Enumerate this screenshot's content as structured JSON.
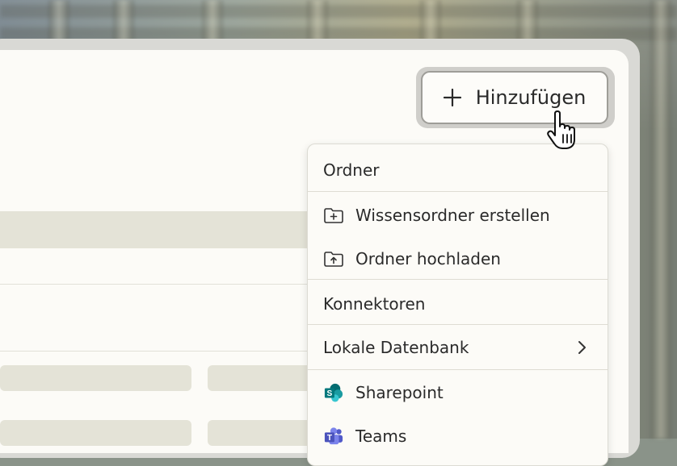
{
  "header": {
    "add_button_label": "Hinzufügen",
    "add_button_icon": "plus-icon"
  },
  "dropdown": {
    "sections": [
      {
        "title": "Ordner",
        "items": [
          {
            "label": "Wissensordner erstellen",
            "icon": "folder-plus-icon"
          },
          {
            "label": "Ordner hochladen",
            "icon": "folder-upload-icon"
          }
        ]
      },
      {
        "title": "Konnektoren",
        "items": [
          {
            "label": "Lokale Datenbank",
            "icon": "chevron-right-icon",
            "has_submenu": true
          },
          {
            "label": "Sharepoint",
            "icon": "sharepoint-icon"
          },
          {
            "label": "Teams",
            "icon": "teams-icon"
          }
        ]
      }
    ]
  },
  "colors": {
    "panel": "#fcfbf7",
    "placeholder": "#e4e3d7",
    "sharepoint": "#0f7b78",
    "teams": "#5059c9"
  }
}
